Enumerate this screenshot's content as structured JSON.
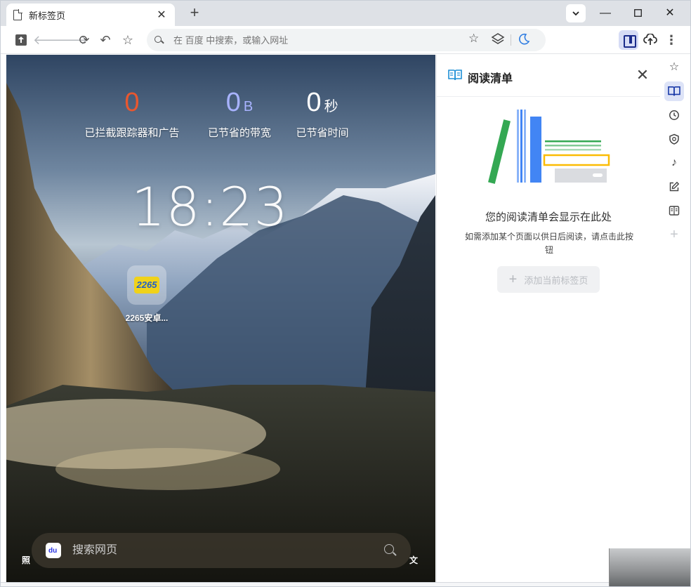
{
  "tab": {
    "title": "新标签页"
  },
  "omnibox": {
    "placeholder": "在 百度 中搜索，或输入网址"
  },
  "stats": {
    "blocked": {
      "value": "0",
      "unit": "",
      "label": "已拦截跟踪器和广告",
      "color": "#e8572f"
    },
    "bandwidth": {
      "value": "0",
      "unit": "B",
      "label": "已节省的带宽",
      "color": "#a8b3ff"
    },
    "time": {
      "value": "0",
      "unit": "秒",
      "label": "已节省时间",
      "color": "#ffffff"
    }
  },
  "clock": "18:23",
  "shortcut": {
    "logo_text": "2265",
    "name": "2265安卓..."
  },
  "search": {
    "placeholder": "搜索网页"
  },
  "corners": {
    "left": "照",
    "right": "文"
  },
  "panel": {
    "title": "阅读清单",
    "empty_title": "您的阅读清单会显示在此处",
    "empty_desc": "如需添加某个页面以供日后阅读，请点击此按钮",
    "add_button": "添加当前标签页"
  },
  "icons": {
    "tab_doc": "document-icon",
    "rail": [
      "star-icon",
      "reading-list-icon",
      "history-icon",
      "shield-icon",
      "music-note-icon",
      "edit-icon",
      "book-icon",
      "plus-icon"
    ]
  },
  "colors": {
    "accent": "#1a3aa8",
    "panel_icon": "#1e8fd6"
  }
}
